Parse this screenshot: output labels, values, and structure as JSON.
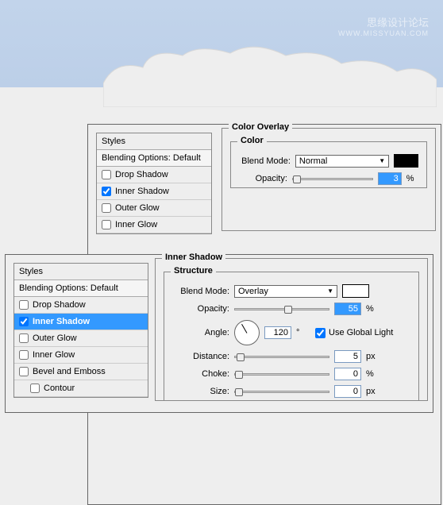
{
  "watermark": {
    "main": "思缘设计论坛",
    "sub": "WWW.MISSYUAN.COM"
  },
  "panel1": {
    "styles_header": "Styles",
    "blending_options": "Blending Options: Default",
    "items": [
      {
        "label": "Drop Shadow",
        "checked": false
      },
      {
        "label": "Inner Shadow",
        "checked": true
      },
      {
        "label": "Outer Glow",
        "checked": false
      },
      {
        "label": "Inner Glow",
        "checked": false
      }
    ],
    "overlay": {
      "group_title": "Color Overlay",
      "subgroup_title": "Color",
      "blend_mode_label": "Blend Mode:",
      "blend_mode_value": "Normal",
      "swatch_color": "#000000",
      "opacity_label": "Opacity:",
      "opacity_value": "3",
      "opacity_unit": "%"
    }
  },
  "panel2": {
    "styles_header": "Styles",
    "blending_options": "Blending Options: Default",
    "items": [
      {
        "label": "Drop Shadow",
        "checked": false
      },
      {
        "label": "Inner Shadow",
        "checked": true,
        "selected": true
      },
      {
        "label": "Outer Glow",
        "checked": false
      },
      {
        "label": "Inner Glow",
        "checked": false
      },
      {
        "label": "Bevel and Emboss",
        "checked": false
      },
      {
        "label": "Contour",
        "checked": false,
        "indent": true
      }
    ],
    "shadow": {
      "group_title": "Inner Shadow",
      "subgroup_title": "Structure",
      "blend_mode_label": "Blend Mode:",
      "blend_mode_value": "Overlay",
      "swatch_color": "#ffffff",
      "opacity_label": "Opacity:",
      "opacity_value": "55",
      "opacity_unit": "%",
      "angle_label": "Angle:",
      "angle_value": "120",
      "angle_unit": "°",
      "global_light_label": "Use Global Light",
      "global_light_checked": true,
      "distance_label": "Distance:",
      "distance_value": "5",
      "distance_unit": "px",
      "choke_label": "Choke:",
      "choke_value": "0",
      "choke_unit": "%",
      "size_label": "Size:",
      "size_value": "0",
      "size_unit": "px"
    }
  }
}
